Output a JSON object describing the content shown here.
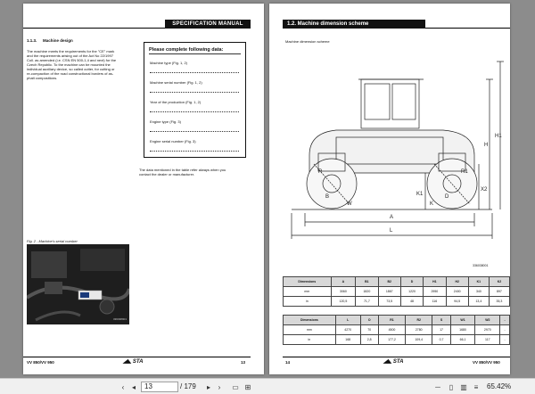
{
  "left_page": {
    "header": "SPECIFICATION MANUAL",
    "section_number": "1.1.3.",
    "section_title": "Machine design",
    "body_lines": [
      "The machine meets the requirements for the \"CE\" mark",
      "and the requirements arising out of the Act No 22/1997",
      "Coll. as amended (i.e. CSN EN 500-1,4 and next) for the",
      "Czech Republic. To the machine can be mounted the",
      "individual auxiliary device, so called cutter, for cutting or",
      "re-compaction of the road constructional borders of as-",
      "phalt compositions."
    ],
    "form": {
      "title": "Please complete following data:",
      "fields": [
        "Machine type (Fig. 1, 2)",
        "Machine serial number (Fig. 1, 2)",
        "Year of the production (Fig. 1, 2)",
        "Engine type (Fig. 3)",
        "Engine serial number (Fig. 3)"
      ]
    },
    "note_lines": [
      "The data mentioned in the table refer always when you",
      "contact the dealer or manufacturer."
    ],
    "figure_caption": "Fig. 2 - Machine's serial number",
    "figure_code": "336038901",
    "footer_model": "VV 850/VV 950",
    "footer_logo": "STA",
    "page_number": "13"
  },
  "right_page": {
    "header": "1.2. Machine dimension scheme",
    "figure_title": "Machine dimension scheme",
    "figure_code": "336038001",
    "drawing_labels": [
      "H",
      "H1",
      "A",
      "L",
      "K1",
      "X2",
      "B",
      "D",
      "R",
      "R1",
      "K",
      "W"
    ],
    "table1": {
      "headers": [
        "Dimensions",
        "A",
        "B1",
        "B2",
        "D",
        "H1",
        "H2",
        "K1",
        "K2"
      ],
      "rows": [
        [
          "mm",
          "3060",
          "1820",
          "1867",
          "1220",
          "2950",
          "2400",
          "340",
          "897"
        ],
        [
          "in",
          "120,5",
          "71,7",
          "73,5",
          "48",
          "116",
          "94,5",
          "13,4",
          "35,3"
        ]
      ]
    },
    "table2": {
      "headers": [
        "Dimensions",
        "L",
        "O",
        "R1",
        "R2",
        "S",
        "W1",
        "W2",
        "-"
      ],
      "rows": [
        [
          "mm",
          "4270",
          "70",
          "4500",
          "2780",
          "17",
          "1680",
          "2970",
          "-"
        ],
        [
          "in",
          "168",
          "2,8",
          "177,2",
          "109,4",
          "0,7",
          "66,1",
          "117",
          "-"
        ]
      ]
    },
    "page_number": "14",
    "footer_logo": "STA",
    "footer_model": "VV 850/VV 950"
  },
  "toolbar": {
    "current_page": "13",
    "total_pages": "/ 179",
    "zoom": "65.42%"
  }
}
